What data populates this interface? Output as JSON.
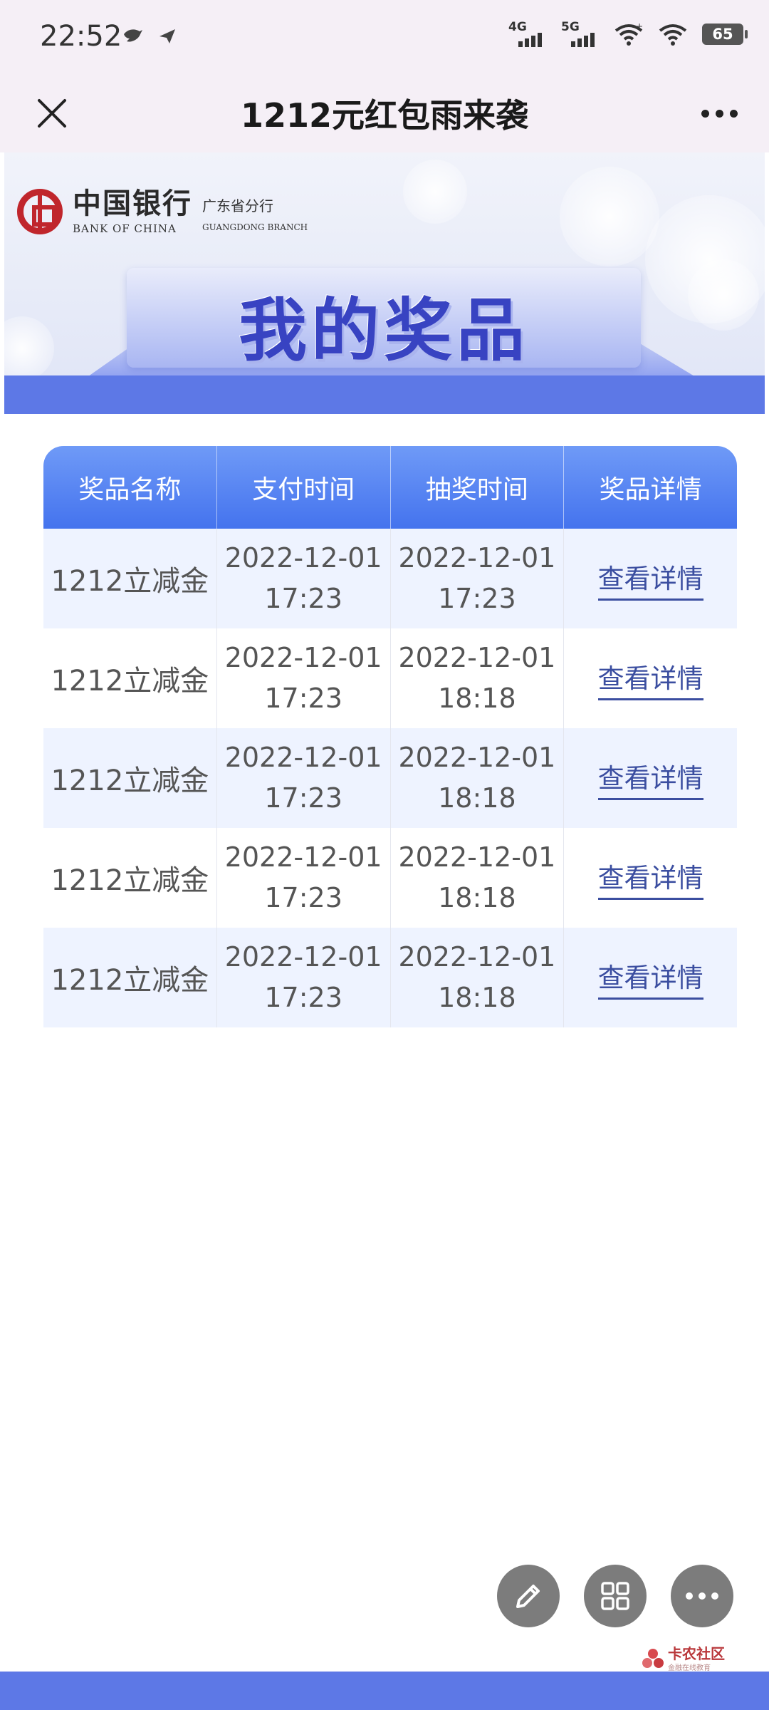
{
  "status_bar": {
    "time": "22:52",
    "left_icons": [
      "bird-icon",
      "send-icon"
    ],
    "network": [
      {
        "label": "4G"
      },
      {
        "label": "5G"
      }
    ],
    "battery": "65"
  },
  "nav": {
    "title": "1212元红包雨来袭",
    "close_icon": "close-icon",
    "more_icon": "more-icon"
  },
  "banner": {
    "bank_name_cn": "中国银行",
    "bank_name_en": "BANK OF CHINA",
    "branch_cn": "广东省分行",
    "branch_en": "GUANGDONG BRANCH",
    "title": "我的奖品"
  },
  "table": {
    "headers": [
      "奖品名称",
      "支付时间",
      "抽奖时间",
      "奖品详情"
    ],
    "rows": [
      {
        "name": "1212立减金",
        "pay_date": "2022-12-01",
        "pay_time": "17:23",
        "draw_date": "2022-12-01",
        "draw_time": "17:23",
        "detail": "查看详情"
      },
      {
        "name": "1212立减金",
        "pay_date": "2022-12-01",
        "pay_time": "17:23",
        "draw_date": "2022-12-01",
        "draw_time": "18:18",
        "detail": "查看详情"
      },
      {
        "name": "1212立减金",
        "pay_date": "2022-12-01",
        "pay_time": "17:23",
        "draw_date": "2022-12-01",
        "draw_time": "18:18",
        "detail": "查看详情"
      },
      {
        "name": "1212立减金",
        "pay_date": "2022-12-01",
        "pay_time": "17:23",
        "draw_date": "2022-12-01",
        "draw_time": "18:18",
        "detail": "查看详情"
      },
      {
        "name": "1212立减金",
        "pay_date": "2022-12-01",
        "pay_time": "17:23",
        "draw_date": "2022-12-01",
        "draw_time": "18:18",
        "detail": "查看详情"
      }
    ]
  },
  "floating_buttons": [
    "edit-icon",
    "apps-grid-icon",
    "more-icon"
  ],
  "watermark": {
    "main": "卡农社区",
    "sub": "金融在线教育"
  },
  "colors": {
    "accent": "#4473ee",
    "banner_base": "#5d78e6",
    "link": "#3b4ea0",
    "title": "#3843c2",
    "bank_red": "#c0262c"
  }
}
